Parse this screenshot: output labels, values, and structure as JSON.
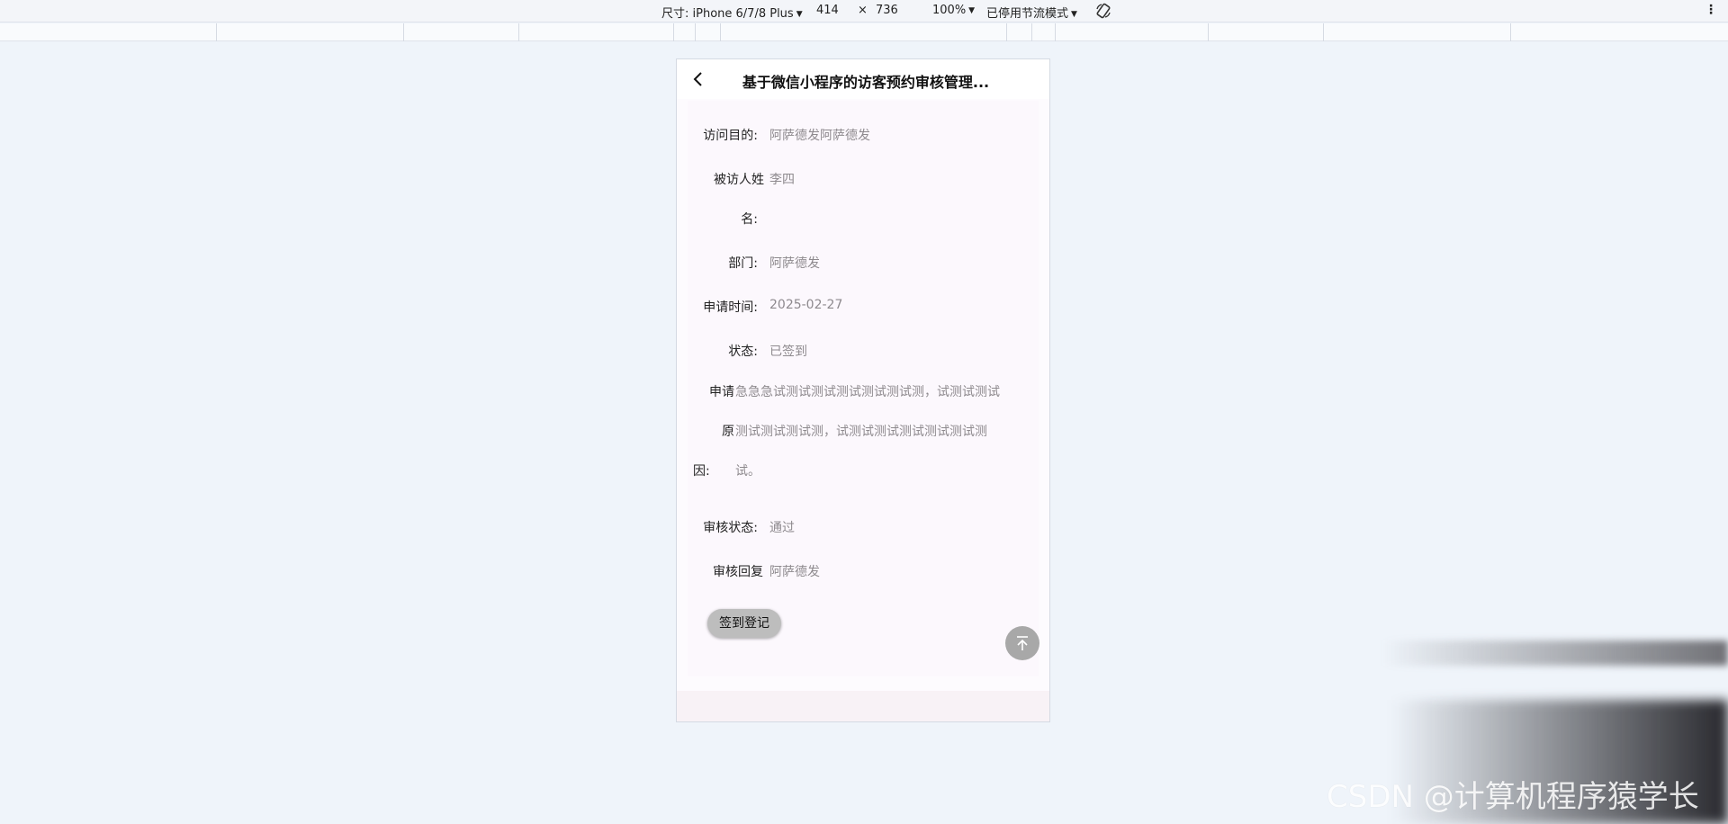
{
  "devtools": {
    "size_label": "尺寸: iPhone 6/7/8 Plus",
    "width": "414",
    "times": "×",
    "height": "736",
    "zoom": "100%",
    "throttle": "已停用节流模式",
    "rotate_icon": "rotate-icon",
    "more_icon": "kebab-icon"
  },
  "nav": {
    "title": "基于微信小程序的访客预约审核管理...",
    "back_icon": "chevron-left-icon"
  },
  "fields": [
    {
      "label": "访问目的:",
      "value": "阿萨德发阿萨德发"
    },
    {
      "label": "被访人姓",
      "label2": "名:",
      "value": "李四"
    },
    {
      "label": "部门:",
      "value": "阿萨德发"
    },
    {
      "label": "申请时间:",
      "value": "2025-02-27"
    },
    {
      "label": "状态:",
      "value": "已签到"
    },
    {
      "label_lines": [
        "申请",
        "原",
        "因:"
      ],
      "value_lines": [
        "急急急试测试测试测试测试测试测，试测试测试",
        "测试测试测试测，试测试测试测试测试测试测",
        "试。"
      ]
    },
    {
      "label": "审核状态:",
      "value": "通过"
    },
    {
      "label": "审核回复",
      "value": "阿萨德发"
    }
  ],
  "actions": {
    "signin_label": "签到登记",
    "top_icon": "arrow-up-to-top-icon"
  },
  "watermark": "CSDN @计算机程序猿学长",
  "colors": {
    "page_bg": "#eff4fa",
    "value_text": "#8e8a8e",
    "button_bg": "#bdbdbd",
    "top_button_bg": "#a8a8a8"
  }
}
